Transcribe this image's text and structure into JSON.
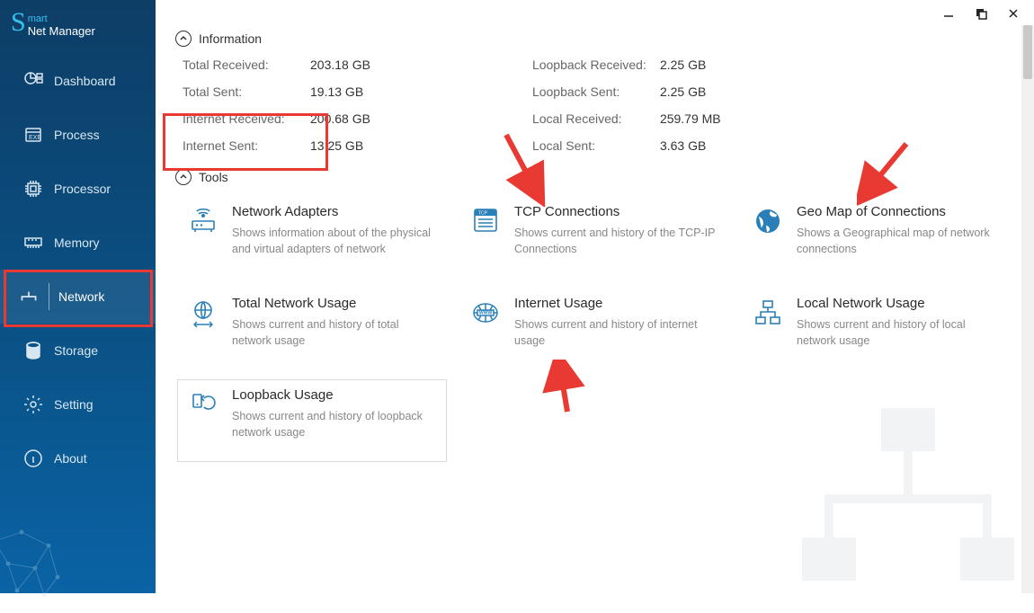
{
  "app": {
    "name_mart": "mart",
    "name_nm": "Net Manager"
  },
  "nav": {
    "items": [
      {
        "key": "dashboard",
        "label": "Dashboard"
      },
      {
        "key": "process",
        "label": "Process"
      },
      {
        "key": "processor",
        "label": "Processor"
      },
      {
        "key": "memory",
        "label": "Memory"
      },
      {
        "key": "network",
        "label": "Network",
        "active": true
      },
      {
        "key": "storage",
        "label": "Storage"
      },
      {
        "key": "setting",
        "label": "Setting"
      },
      {
        "key": "about",
        "label": "About"
      }
    ]
  },
  "sections": {
    "information_title": "Information",
    "tools_title": "Tools"
  },
  "info": {
    "left": [
      {
        "k": "Total Received:",
        "v": "203.18 GB"
      },
      {
        "k": "Total Sent:",
        "v": "19.13 GB"
      },
      {
        "k": "Internet Received:",
        "v": "200.68 GB"
      },
      {
        "k": "Internet Sent:",
        "v": "13.25 GB"
      }
    ],
    "right": [
      {
        "k": "Loopback Received:",
        "v": "2.25 GB"
      },
      {
        "k": "Loopback Sent:",
        "v": "2.25 GB"
      },
      {
        "k": "Local Received:",
        "v": "259.79 MB"
      },
      {
        "k": "Local Sent:",
        "v": "3.63 GB"
      }
    ]
  },
  "tools": [
    {
      "key": "network-adapters",
      "title": "Network Adapters",
      "desc": "Shows information about of the physical and virtual adapters of network"
    },
    {
      "key": "tcp-connections",
      "title": "TCP Connections",
      "desc": "Shows current and history of the TCP-IP Connections"
    },
    {
      "key": "geo-map",
      "title": "Geo Map of Connections",
      "desc": "Shows a Geographical map of network connections"
    },
    {
      "key": "total-usage",
      "title": "Total Network Usage",
      "desc": "Shows current and history of total network usage"
    },
    {
      "key": "internet-usage",
      "title": "Internet Usage",
      "desc": "Shows current and history of internet usage"
    },
    {
      "key": "local-usage",
      "title": "Local Network Usage",
      "desc": "Shows current and history of local network usage"
    },
    {
      "key": "loopback-usage",
      "title": "Loopback Usage",
      "desc": "Shows current and history of loopback network usage",
      "selected": true
    }
  ],
  "colors": {
    "accent": "#2a7fb8",
    "red": "#e83a32",
    "iconblue": "#2a7fb8"
  }
}
